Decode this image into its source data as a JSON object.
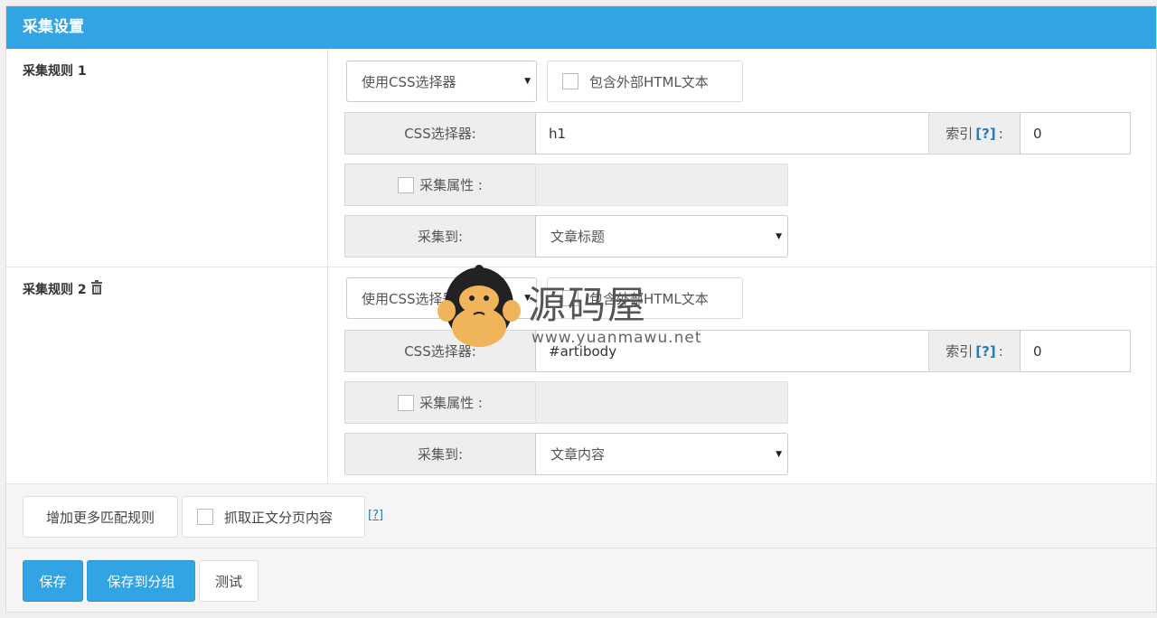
{
  "header": {
    "title": "采集设置"
  },
  "rules": [
    {
      "label": "采集规则 1",
      "selector_type": "使用CSS选择器",
      "include_outer_html": "包含外部HTML文本",
      "css_selector_label": "CSS选择器:",
      "css_selector_value": "h1",
      "index_label": "索引",
      "index_help": "[?]",
      "index_colon": ":",
      "index_value": "0",
      "attr_label": "采集属性 :",
      "target_label": "采集到:",
      "target_value": "文章标题"
    },
    {
      "label": "采集规则 2",
      "selector_type": "使用CSS选择器",
      "include_outer_html": "包含外部HTML文本",
      "css_selector_label": "CSS选择器:",
      "css_selector_value": "#artibody",
      "index_label": "索引",
      "index_help": "[?]",
      "index_colon": ":",
      "index_value": "0",
      "attr_label": "采集属性 :",
      "target_label": "采集到:",
      "target_value": "文章内容"
    }
  ],
  "footer": {
    "add_rule_label": "增加更多匹配规则",
    "paging_label": "抓取正文分页内容",
    "paging_help": "[?]",
    "save_label": "保存",
    "save_group_label": "保存到分组",
    "test_label": "测试"
  },
  "watermark": {
    "brand": "源码屋",
    "url": "www.yuanmawu.net"
  },
  "colors": {
    "accent": "#32a3e3",
    "link": "#2a7ab8"
  }
}
